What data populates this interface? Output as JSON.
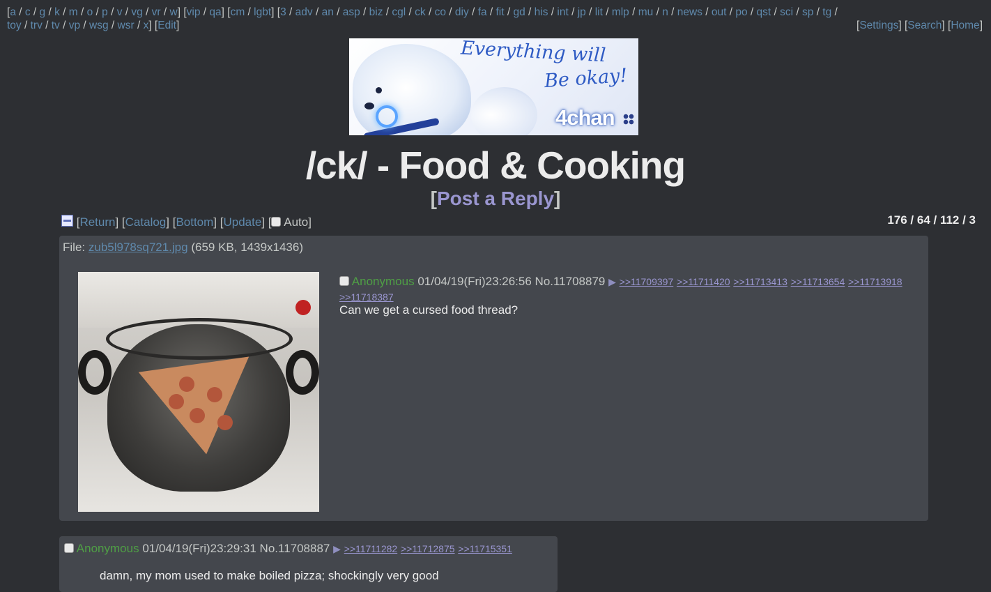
{
  "nav": {
    "line1": [
      "a",
      "c",
      "g",
      "k",
      "m",
      "o",
      "p",
      "v",
      "vg",
      "vr",
      "w"
    ],
    "group2": [
      "vip",
      "qa"
    ],
    "group3": [
      "cm",
      "lgbt"
    ],
    "group4": [
      "3",
      "adv",
      "an",
      "asp",
      "biz",
      "cgl",
      "ck",
      "co",
      "diy",
      "fa",
      "fit",
      "gd",
      "his",
      "int",
      "jp",
      "lit",
      "mlp",
      "mu",
      "n",
      "news",
      "out",
      "po",
      "qst",
      "sci",
      "sp",
      "tg"
    ],
    "line2": [
      "toy",
      "trv",
      "tv",
      "vp",
      "wsg",
      "wsr",
      "x"
    ],
    "edit": "Edit",
    "right": [
      "Settings",
      "Search",
      "Home"
    ]
  },
  "banner": {
    "line1": "Everything will",
    "line2": "Be okay!",
    "brand": "4chan"
  },
  "board": {
    "title": "/ck/ - Food & Cooking",
    "post_reply": "Post a Reply"
  },
  "thread_nav": {
    "return": "Return",
    "catalog": "Catalog",
    "bottom": "Bottom",
    "update": "Update",
    "auto": "Auto"
  },
  "stats": "176 / 64 / 112 / 3",
  "op": {
    "file_label": "File:",
    "file_name": "zub5l978sq721.jpg",
    "file_meta": "(659 KB, 1439x1436)",
    "name": "Anonymous",
    "datetime": "01/04/19(Fri)23:26:56",
    "number": "No.11708879",
    "replies": [
      ">>11709397",
      ">>11711420",
      ">>11713413",
      ">>11713654",
      ">>11713918",
      ">>11718387"
    ],
    "message": "Can we get a cursed food thread?"
  },
  "reply1": {
    "name": "Anonymous",
    "datetime": "01/04/19(Fri)23:29:31",
    "number": "No.11708887",
    "replies": [
      ">>11711282",
      ">>11712875",
      ">>11715351"
    ],
    "message": "damn, my mom used to make boiled pizza; shockingly very good"
  },
  "colors": {
    "background": "#2d2f33",
    "post_bg": "#44474d",
    "link": "#5f89ac",
    "name": "#4f9f45",
    "reply_link": "#9a96d0"
  }
}
